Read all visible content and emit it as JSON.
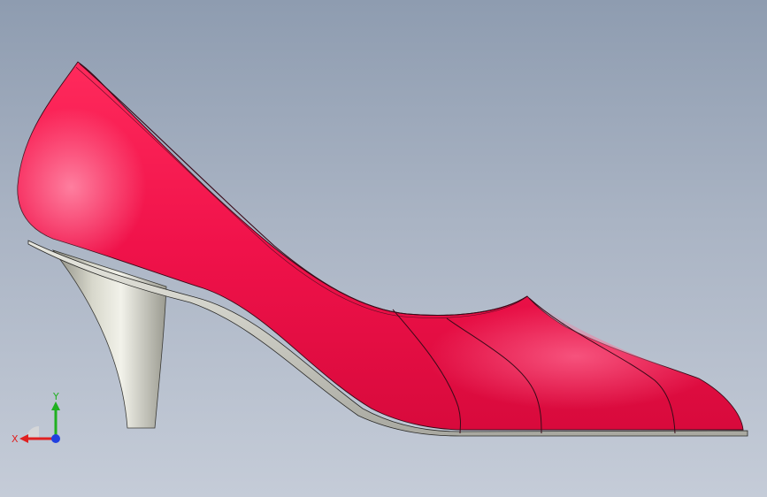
{
  "viewport": {
    "background_top": "#8e9cb0",
    "background_bottom": "#c5ccd8"
  },
  "model": {
    "upper_color": "#f0124a",
    "sole_color": "#d8d8d0",
    "heel_color": "#b8b8b0"
  },
  "triad": {
    "x_label": "X",
    "y_label": "Y",
    "x_color": "#e02020",
    "y_color": "#20b020",
    "z_color": "#2040e0"
  }
}
